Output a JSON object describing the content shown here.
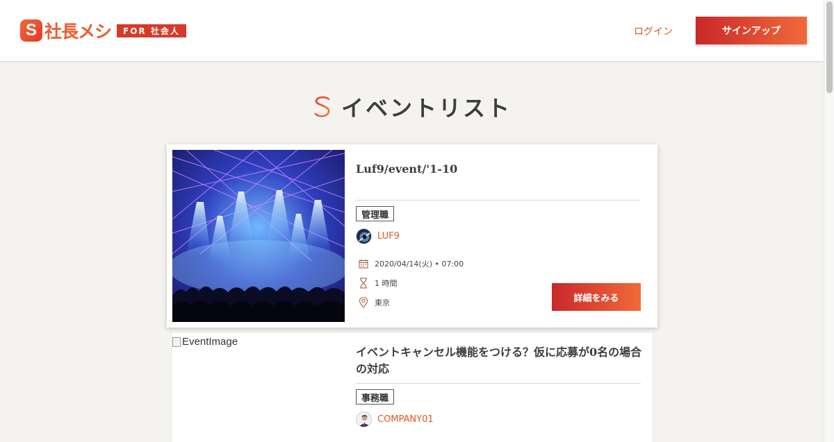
{
  "header": {
    "logo_mark": "S",
    "logo_text": "社長メシ",
    "logo_tag": "FOR 社会人",
    "login_label": "ログイン",
    "signup_label": "サインアップ"
  },
  "page": {
    "title": "イベントリスト"
  },
  "events": [
    {
      "title": "Luf9/event/'1-10",
      "category": "管理職",
      "company": "LUF9",
      "date": "2020/04/14(火) • 07:00",
      "duration": "1 時間",
      "location": "東京",
      "detail_label": "詳細をみる",
      "image": "concert-light-show"
    },
    {
      "title": "イベントキャンセル機能をつける？仮に応募が0名の場合の対応",
      "category": "事務職",
      "company": "COMPANY01",
      "image_alt": "EventImage"
    }
  ],
  "colors": {
    "accent": "#e0572c",
    "brand_red": "#c9282a",
    "brand_orange": "#f06a3a",
    "background": "#f4f3f0"
  },
  "icons": [
    "calendar-icon",
    "hourglass-icon",
    "map-pin-icon",
    "brand-s-icon"
  ]
}
